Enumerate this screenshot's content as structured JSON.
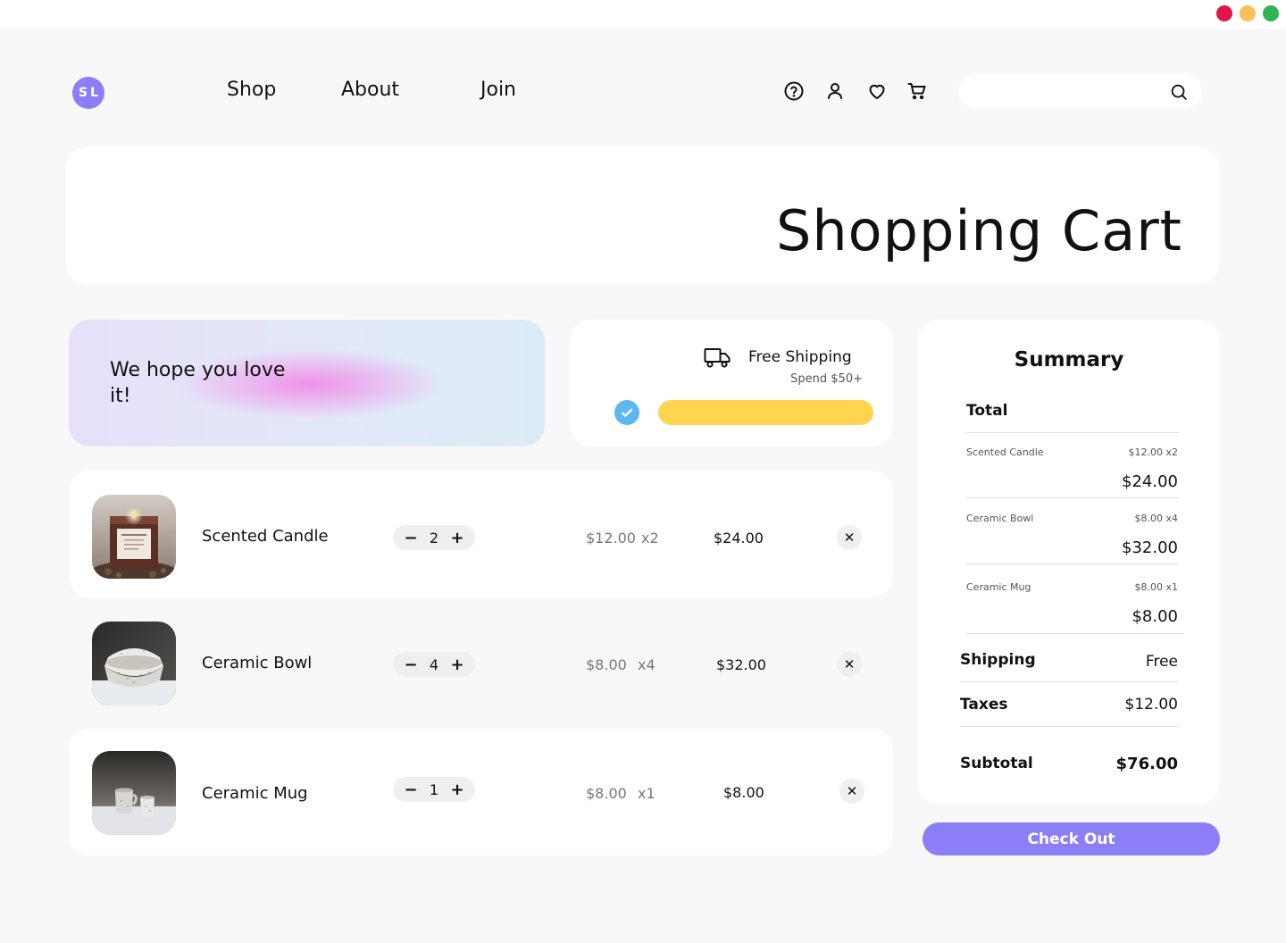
{
  "brand": {
    "logo": "SL"
  },
  "nav": {
    "items": [
      "Shop",
      "About",
      "Join"
    ]
  },
  "header_icons": [
    "help-icon",
    "account-icon",
    "wishlist-heart-icon",
    "cart-icon",
    "search-icon"
  ],
  "search": {
    "value": "",
    "placeholder": ""
  },
  "page": {
    "title": "Shopping Cart"
  },
  "promo": {
    "text": "We hope you love it!"
  },
  "shipping": {
    "title": "Free Shipping",
    "subtitle": "Spend $50+",
    "progress_percent": 100,
    "qualified": true
  },
  "cart": {
    "items": [
      {
        "name": "Scented Candle",
        "qty": "2",
        "unit_price": "$12.00",
        "multiplier": "x2",
        "total": "$24.00"
      },
      {
        "name": "Ceramic Bowl",
        "qty": "4",
        "unit_price": "$8.00",
        "multiplier": "x4",
        "total": "$32.00"
      },
      {
        "name": "Ceramic Mug",
        "qty": "1",
        "unit_price": "$8.00",
        "multiplier": "x1",
        "total": "$8.00"
      }
    ]
  },
  "summary": {
    "title": "Summary",
    "total_label": "Total",
    "items": [
      {
        "name": "Scented Candle",
        "unit": "$12.00 x2",
        "total": "$24.00"
      },
      {
        "name": "Ceramic Bowl",
        "unit": "$8.00 x4",
        "total": "$32.00"
      },
      {
        "name": "Ceramic Mug",
        "unit": "$8.00 x1",
        "total": "$8.00"
      }
    ],
    "shipping_label": "Shipping",
    "shipping_value": "Free",
    "taxes_label": "Taxes",
    "taxes_value": "$12.00",
    "subtotal_label": "Subtotal",
    "subtotal_value": "$76.00"
  },
  "checkout": {
    "label": "Check Out"
  },
  "colors": {
    "accent": "#8b7ef7",
    "progress": "#ffd54f",
    "check": "#5bb8f2"
  }
}
